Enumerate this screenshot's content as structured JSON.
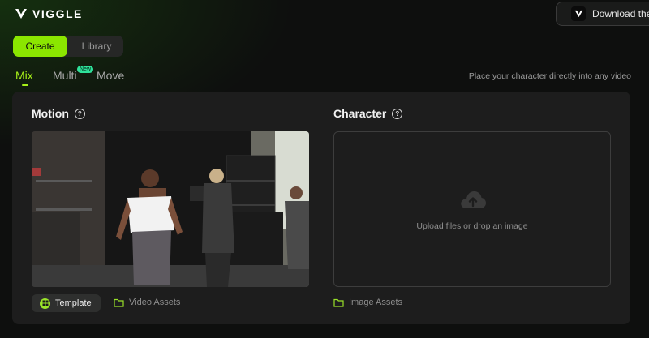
{
  "header": {
    "brand": "VIGGLE",
    "download_label": "Download the"
  },
  "mode_toggle": {
    "create_label": "Create",
    "library_label": "Library",
    "selected": "Create"
  },
  "tabs": [
    {
      "label": "Mix",
      "active": true
    },
    {
      "label": "Multi",
      "badge": "New"
    },
    {
      "label": "Move"
    }
  ],
  "tagline": "Place your character directly into any video",
  "motion": {
    "title": "Motion",
    "help_icon": "question-circle-icon",
    "template_label": "Template",
    "video_assets_label": "Video Assets"
  },
  "character": {
    "title": "Character",
    "help_icon": "question-circle-icon",
    "upload_text": "Upload files or drop an image",
    "upload_icon": "cloud-upload-icon",
    "image_assets_label": "Image Assets"
  },
  "colors": {
    "accent": "#8be600",
    "badge_new": "#2fe29a",
    "panel_bg": "#1d1d1d"
  }
}
